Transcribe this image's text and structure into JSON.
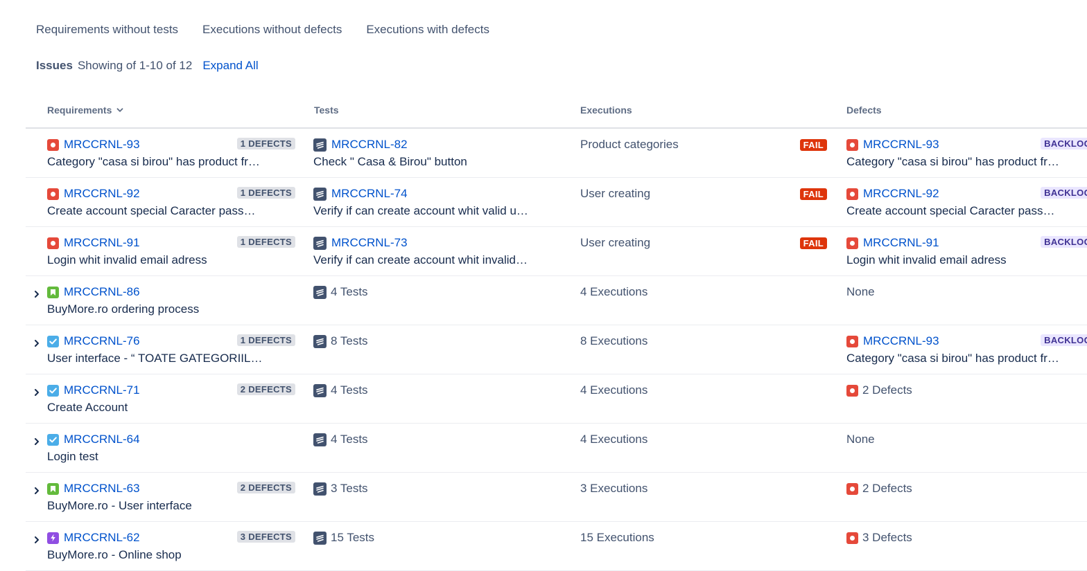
{
  "tabs": [
    "Requirements without tests",
    "Executions without defects",
    "Executions with defects"
  ],
  "summary": {
    "label": "Issues",
    "count_text": "Showing of 1-10 of 12",
    "expand_all": "Expand All"
  },
  "columns": {
    "requirements": "Requirements",
    "tests": "Tests",
    "executions": "Executions",
    "defects": "Defects"
  },
  "rows": [
    {
      "expandable": false,
      "requirement": {
        "icon": "bug-icon",
        "key": "MRCCRNL-93",
        "summary": "Category \"casa si birou\" has product fr…",
        "defects_badge": "1 DEFECTS"
      },
      "tests": {
        "key": "MRCCRNL-82",
        "summary": "Check \" Casa & Birou\" button"
      },
      "executions": {
        "text": "Product categories",
        "status": "FAIL"
      },
      "defects": {
        "icon": "bug-icon",
        "key": "MRCCRNL-93",
        "summary": "Category \"casa si birou\" has product fr…",
        "status": "BACKLOG"
      }
    },
    {
      "expandable": false,
      "requirement": {
        "icon": "bug-icon",
        "key": "MRCCRNL-92",
        "summary": "Create account special Caracter pass…",
        "defects_badge": "1 DEFECTS"
      },
      "tests": {
        "key": "MRCCRNL-74",
        "summary": "Verify if can create account whit valid u…"
      },
      "executions": {
        "text": "User creating",
        "status": "FAIL"
      },
      "defects": {
        "icon": "bug-icon",
        "key": "MRCCRNL-92",
        "summary": "Create account special Caracter pass…",
        "status": "BACKLOG"
      }
    },
    {
      "expandable": false,
      "requirement": {
        "icon": "bug-icon",
        "key": "MRCCRNL-91",
        "summary": "Login whit invalid email adress",
        "defects_badge": "1 DEFECTS"
      },
      "tests": {
        "key": "MRCCRNL-73",
        "summary": "Verify if can create account whit invalid…"
      },
      "executions": {
        "text": "User creating",
        "status": "FAIL"
      },
      "defects": {
        "icon": "bug-icon",
        "key": "MRCCRNL-91",
        "summary": "Login whit invalid email adress",
        "status": "BACKLOG"
      }
    },
    {
      "expandable": true,
      "requirement": {
        "icon": "story-icon",
        "key": "MRCCRNL-86",
        "summary": "BuyMore.ro ordering process",
        "defects_badge": ""
      },
      "tests": {
        "count_text": "4 Tests"
      },
      "executions": {
        "text": "4 Executions"
      },
      "defects": {
        "text": "None"
      }
    },
    {
      "expandable": true,
      "requirement": {
        "icon": "task-icon",
        "key": "MRCCRNL-76",
        "summary": "User interface - “ TOATE GATEGORIIL…",
        "defects_badge": "1 DEFECTS"
      },
      "tests": {
        "count_text": "8 Tests"
      },
      "executions": {
        "text": "8 Executions"
      },
      "defects": {
        "icon": "bug-icon",
        "key": "MRCCRNL-93",
        "summary": "Category \"casa si birou\" has product fr…",
        "status": "BACKLOG"
      }
    },
    {
      "expandable": true,
      "requirement": {
        "icon": "task-icon",
        "key": "MRCCRNL-71",
        "summary": "Create Account",
        "defects_badge": "2 DEFECTS"
      },
      "tests": {
        "count_text": "4 Tests"
      },
      "executions": {
        "text": "4 Executions"
      },
      "defects": {
        "icon": "bug-icon",
        "count_text": "2 Defects"
      }
    },
    {
      "expandable": true,
      "requirement": {
        "icon": "task-icon",
        "key": "MRCCRNL-64",
        "summary": "Login test",
        "defects_badge": ""
      },
      "tests": {
        "count_text": "4 Tests"
      },
      "executions": {
        "text": "4 Executions"
      },
      "defects": {
        "text": "None"
      }
    },
    {
      "expandable": true,
      "requirement": {
        "icon": "story-icon",
        "key": "MRCCRNL-63",
        "summary": "BuyMore.ro - User interface",
        "defects_badge": "2 DEFECTS"
      },
      "tests": {
        "count_text": "3 Tests"
      },
      "executions": {
        "text": "3 Executions"
      },
      "defects": {
        "icon": "bug-icon",
        "count_text": "2 Defects"
      }
    },
    {
      "expandable": true,
      "requirement": {
        "icon": "epic-icon",
        "key": "MRCCRNL-62",
        "summary": "BuyMore.ro - Online shop",
        "defects_badge": "3 DEFECTS"
      },
      "tests": {
        "count_text": "15 Tests"
      },
      "executions": {
        "text": "15 Executions"
      },
      "defects": {
        "icon": "bug-icon",
        "count_text": "3 Defects"
      }
    }
  ],
  "colors": {
    "link": "#0052cc",
    "bug": "#e5493a",
    "story": "#63ba3c",
    "task": "#4bade8",
    "epic": "#904ee2",
    "fail": "#de350b",
    "backlog_bg": "#eae6ff",
    "backlog_text": "#403294"
  }
}
